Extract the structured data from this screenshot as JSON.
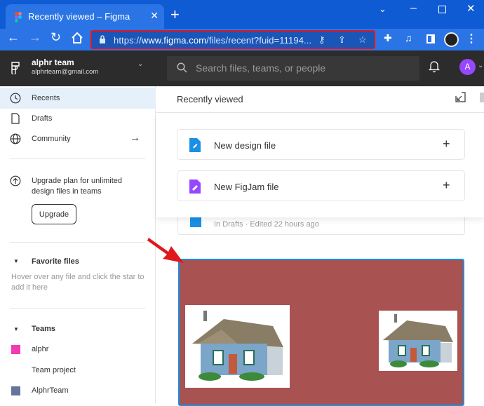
{
  "browser": {
    "tab_title": "Recently viewed – Figma",
    "url_prefix": "https://",
    "url_domain": "www.figma.com",
    "url_path": "/files/recent?fuid=11194..."
  },
  "figma_header": {
    "team_name": "alphr team",
    "team_email": "alphrteam@gmail.com",
    "search_placeholder": "Search files, teams, or people",
    "avatar_initial": "A"
  },
  "sidebar": {
    "items": [
      {
        "label": "Recents",
        "icon": "clock-icon"
      },
      {
        "label": "Drafts",
        "icon": "file-icon"
      },
      {
        "label": "Community",
        "icon": "globe-icon"
      }
    ],
    "upgrade_text": "Upgrade plan for unlimited design files in teams",
    "upgrade_button": "Upgrade",
    "favorites_title": "Favorite files",
    "favorites_hint": "Hover over any file and click the star to add it here",
    "teams_title": "Teams",
    "teams": [
      {
        "label": "alphr",
        "color": "#f13bb4"
      },
      {
        "label": "Team project",
        "color": ""
      },
      {
        "label": "AlphrTeam",
        "color": "#65749a"
      }
    ]
  },
  "main": {
    "title": "Recently viewed",
    "new_files": [
      {
        "label": "New design file",
        "icon": "design-file-icon",
        "color": "#1a8fe3"
      },
      {
        "label": "New FigJam file",
        "icon": "figjam-file-icon",
        "color": "#9747ff"
      }
    ],
    "recent_file_meta": "In Drafts · Edited 22 hours ago",
    "thumbnail_bg": "#a85252"
  },
  "colors": {
    "chrome_blue": "#0f5bd4",
    "figma_dark": "#2c2c2c",
    "highlight_red": "#e0181e",
    "selection_blue": "#1a8fe3"
  }
}
